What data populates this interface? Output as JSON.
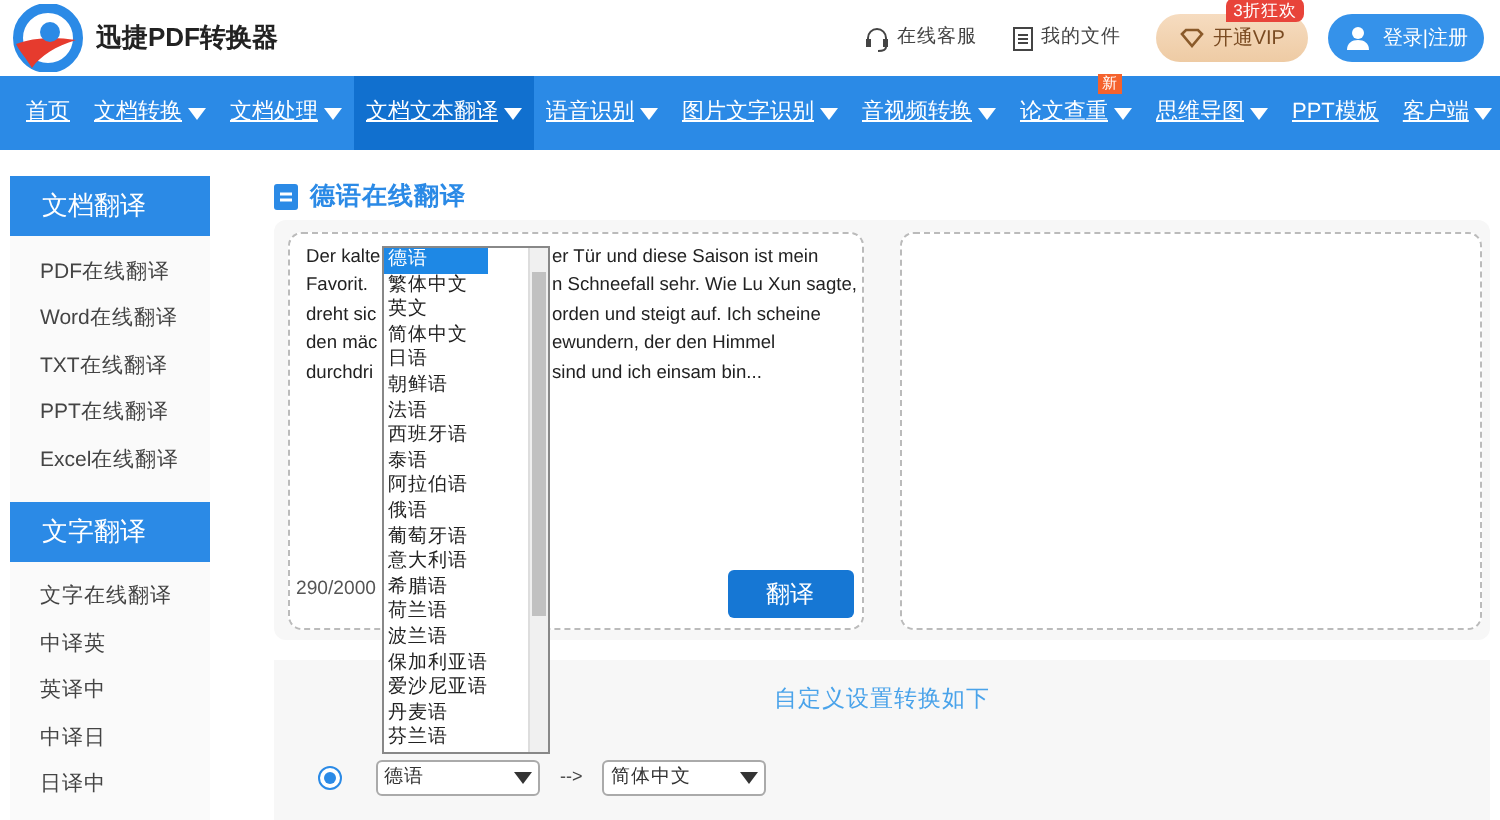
{
  "header": {
    "logo_text": "迅捷PDF转换器",
    "links": [
      {
        "kind": "service",
        "label": "在线客服"
      },
      {
        "kind": "files",
        "label": "我的文件"
      }
    ],
    "vip": {
      "label": "开通VIP",
      "badge": "3折狂欢"
    },
    "login": "登录|注册"
  },
  "nav": [
    {
      "label": "首页",
      "dropdown": false,
      "selected": false
    },
    {
      "label": "文档转换",
      "dropdown": true,
      "selected": false
    },
    {
      "label": "文档处理",
      "dropdown": true,
      "selected": false
    },
    {
      "label": "文档文本翻译",
      "dropdown": true,
      "selected": true
    },
    {
      "label": "语音识别",
      "dropdown": true,
      "selected": false
    },
    {
      "label": "图片文字识别",
      "dropdown": true,
      "selected": false
    },
    {
      "label": "音视频转换",
      "dropdown": true,
      "selected": false
    },
    {
      "label": "论文查重",
      "dropdown": true,
      "selected": false,
      "badge": "新"
    },
    {
      "label": "思维导图",
      "dropdown": true,
      "selected": false
    },
    {
      "label": "PPT模板",
      "dropdown": false,
      "selected": false
    },
    {
      "label": "客户端",
      "dropdown": true,
      "selected": false
    }
  ],
  "sidebar": {
    "sections": [
      {
        "title": "文档翻译",
        "items": [
          "PDF在线翻译",
          "Word在线翻译",
          "TXT在线翻译",
          "PPT在线翻译",
          "Excel在线翻译"
        ]
      },
      {
        "title": "文字翻译",
        "items": [
          "文字在线翻译",
          "中译英",
          "英译中",
          "中译日",
          "日译中"
        ]
      }
    ]
  },
  "main": {
    "title": "德语在线翻译",
    "source": {
      "lines": [
        {
          "left": "Der kalte",
          "right": "er Tür und diese Saison ist mein"
        },
        {
          "left": "Favorit.",
          "right": "n Schneefall sehr. Wie Lu Xun sagte,"
        },
        {
          "left": "dreht sic",
          "right": "orden und steigt auf. Ich scheine"
        },
        {
          "left": "den mäc",
          "right": "ewundern, der den Himmel"
        },
        {
          "left": "durchdri",
          "right": "sind und ich einsam bin..."
        }
      ],
      "count": "290/2000"
    },
    "translate_button": "翻译",
    "language_list": [
      {
        "label": "德语",
        "selected": true
      },
      {
        "label": "繁体中文",
        "selected": false
      },
      {
        "label": "英文",
        "selected": false
      },
      {
        "label": "简体中文",
        "selected": false
      },
      {
        "label": "日语",
        "selected": false
      },
      {
        "label": "朝鲜语",
        "selected": false
      },
      {
        "label": "法语",
        "selected": false
      },
      {
        "label": "西班牙语",
        "selected": false
      },
      {
        "label": "泰语",
        "selected": false
      },
      {
        "label": "阿拉伯语",
        "selected": false
      },
      {
        "label": "俄语",
        "selected": false
      },
      {
        "label": "葡萄牙语",
        "selected": false
      },
      {
        "label": "意大利语",
        "selected": false
      },
      {
        "label": "希腊语",
        "selected": false
      },
      {
        "label": "荷兰语",
        "selected": false
      },
      {
        "label": "波兰语",
        "selected": false
      },
      {
        "label": "保加利亚语",
        "selected": false
      },
      {
        "label": "爱沙尼亚语",
        "selected": false
      },
      {
        "label": "丹麦语",
        "selected": false
      },
      {
        "label": "芬兰语",
        "selected": false
      }
    ],
    "settings": {
      "title": "自定义设置转换如下",
      "radio_checked": true,
      "source_language": "德语",
      "arrow": "-->",
      "target_language": "简体中文"
    }
  }
}
